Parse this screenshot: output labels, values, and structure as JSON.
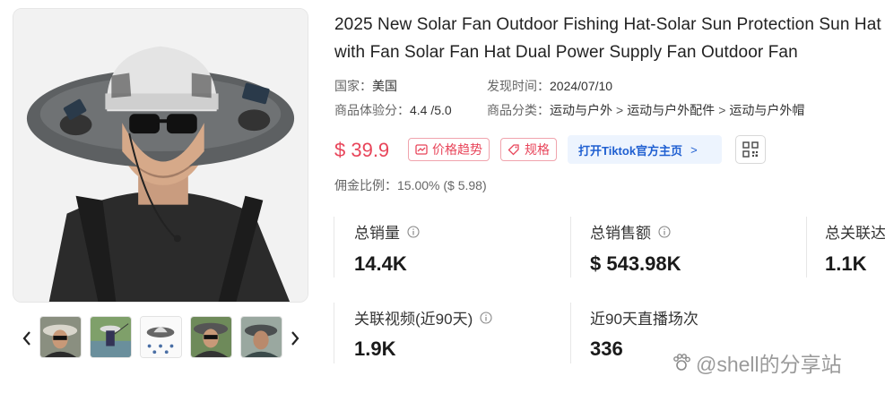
{
  "product": {
    "title": "2025 New Solar Fan Outdoor Fishing Hat-Solar Sun Protection Sun Hat with Fan Solar Fan Hat Dual Power Supply Fan Outdoor Fan",
    "image_alt": "Man wearing a light grey wide-brim bucket hat with solar panel fans"
  },
  "meta": {
    "country_label": "国家：",
    "country_value": "美国",
    "discovered_label": "发现时间：",
    "discovered_value": "2024/07/10",
    "rating_label": "商品体验分：",
    "rating_value": "4.4 /5.0",
    "category_label": "商品分类：",
    "category_path": [
      "运动与户外",
      "运动与户外配件",
      "运动与户外帽"
    ],
    "category_sep": ">"
  },
  "price": "$ 39.9",
  "actions": {
    "price_trend": "价格趋势",
    "spec": "规格",
    "open_tiktok": "打开Tiktok官方主页",
    "open_tiktok_arrow": ">"
  },
  "commission": "佣金比例：15.00% ($ 5.98)",
  "stats": {
    "total_sales_label": "总销量",
    "total_sales_value": "14.4K",
    "total_revenue_label": "总销售额",
    "total_revenue_value": "$ 543.98K",
    "total_related_label": "总关联达",
    "total_related_value": "1.1K",
    "related_videos_label": "关联视频(近90天)",
    "related_videos_value": "1.9K",
    "live_sessions_label": "近90天直播场次",
    "live_sessions_value": "336"
  },
  "watermark": "@shell的分享站",
  "colors": {
    "price_red": "#e8455a",
    "link_blue": "#1f5fd1",
    "tiktok_bg": "#edf4fe"
  },
  "icons": [
    "chevron-left-icon",
    "chevron-right-icon",
    "trend-chart-icon",
    "tag-icon",
    "qr-code-icon",
    "info-icon"
  ]
}
